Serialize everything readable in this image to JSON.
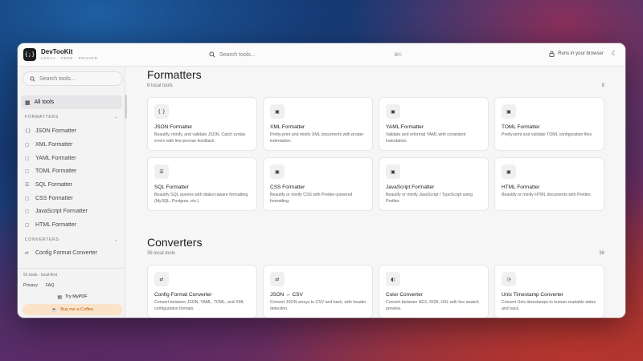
{
  "app": {
    "name": "DevTooKit",
    "tagline": "LOCAL · FREE · PRIVATE",
    "logo_glyph": "{;}"
  },
  "topbar": {
    "search_placeholder": "Search tools...",
    "shortcut": "⌘K",
    "runs_label": "Runs in your browser",
    "theme_icon": "moon-icon"
  },
  "sidebar": {
    "search_placeholder": "Search tools...",
    "all_tools_label": "All tools",
    "sections": [
      {
        "label": "FORMATTERS",
        "items": [
          {
            "label": "JSON Formatter",
            "icon": "{}"
          },
          {
            "label": "XML Formatter",
            "icon": "▢"
          },
          {
            "label": "YAML Formatter",
            "icon": "▢"
          },
          {
            "label": "TOML Formatter",
            "icon": "▢"
          },
          {
            "label": "SQL Formatter",
            "icon": "▢"
          },
          {
            "label": "CSS Formatter",
            "icon": "▢"
          },
          {
            "label": "JavaScript Formatter",
            "icon": "▢"
          },
          {
            "label": "HTML Formatter",
            "icon": "▢"
          }
        ]
      },
      {
        "label": "CONVERTERS",
        "items": [
          {
            "label": "Config Format Converter",
            "icon": "⇄"
          }
        ]
      }
    ],
    "footer": {
      "stat": "91 tools · local-first",
      "links": [
        "Privacy",
        "FAQ"
      ],
      "try_label": "Try MyPDF",
      "coffee_label": "Buy me a Coffee"
    }
  },
  "main": {
    "sections": [
      {
        "title": "Formatters",
        "subtitle": "8 local tools",
        "count": "8",
        "cards": [
          {
            "title": "JSON Formatter",
            "desc": "Beautify, minify, and validate JSON. Catch syntax errors with line-precise feedback.",
            "icon": "{ }"
          },
          {
            "title": "XML Formatter",
            "desc": "Pretty-print and minify XML documents with proper indentation.",
            "icon": "▣"
          },
          {
            "title": "YAML Formatter",
            "desc": "Validate and reformat YAML with consistent indentation.",
            "icon": "▣"
          },
          {
            "title": "TOML Formatter",
            "desc": "Pretty-print and validate TOML configuration files.",
            "icon": "▣"
          },
          {
            "title": "SQL Formatter",
            "desc": "Beautify SQL queries with dialect-aware formatting (MySQL, Postgres, etc.)",
            "icon": "☰"
          },
          {
            "title": "CSS Formatter",
            "desc": "Beautify or minify CSS with Prettier-powered formatting.",
            "icon": "▣"
          },
          {
            "title": "JavaScript Formatter",
            "desc": "Beautify or minify JavaScript / TypeScript using Prettier.",
            "icon": "▣"
          },
          {
            "title": "HTML Formatter",
            "desc": "Beautify or minify HTML documents with Prettier.",
            "icon": "▣"
          }
        ]
      },
      {
        "title": "Converters",
        "subtitle": "36 local tools",
        "count": "36",
        "cards": [
          {
            "title": "Config Format Converter",
            "desc": "Convert between JSON, YAML, TOML, and XML configuration formats.",
            "icon": "⇄"
          },
          {
            "title": "JSON ↔ CSV",
            "desc": "Convert JSON arrays to CSV and back, with header detection.",
            "icon": "⇄"
          },
          {
            "title": "Color Converter",
            "desc": "Convert between HEX, RGB, HSL with live swatch preview.",
            "icon": "◐"
          },
          {
            "title": "Unix Timestamp Converter",
            "desc": "Convert Unix timestamps to human-readable dates and back.",
            "icon": "◷"
          }
        ]
      }
    ]
  }
}
